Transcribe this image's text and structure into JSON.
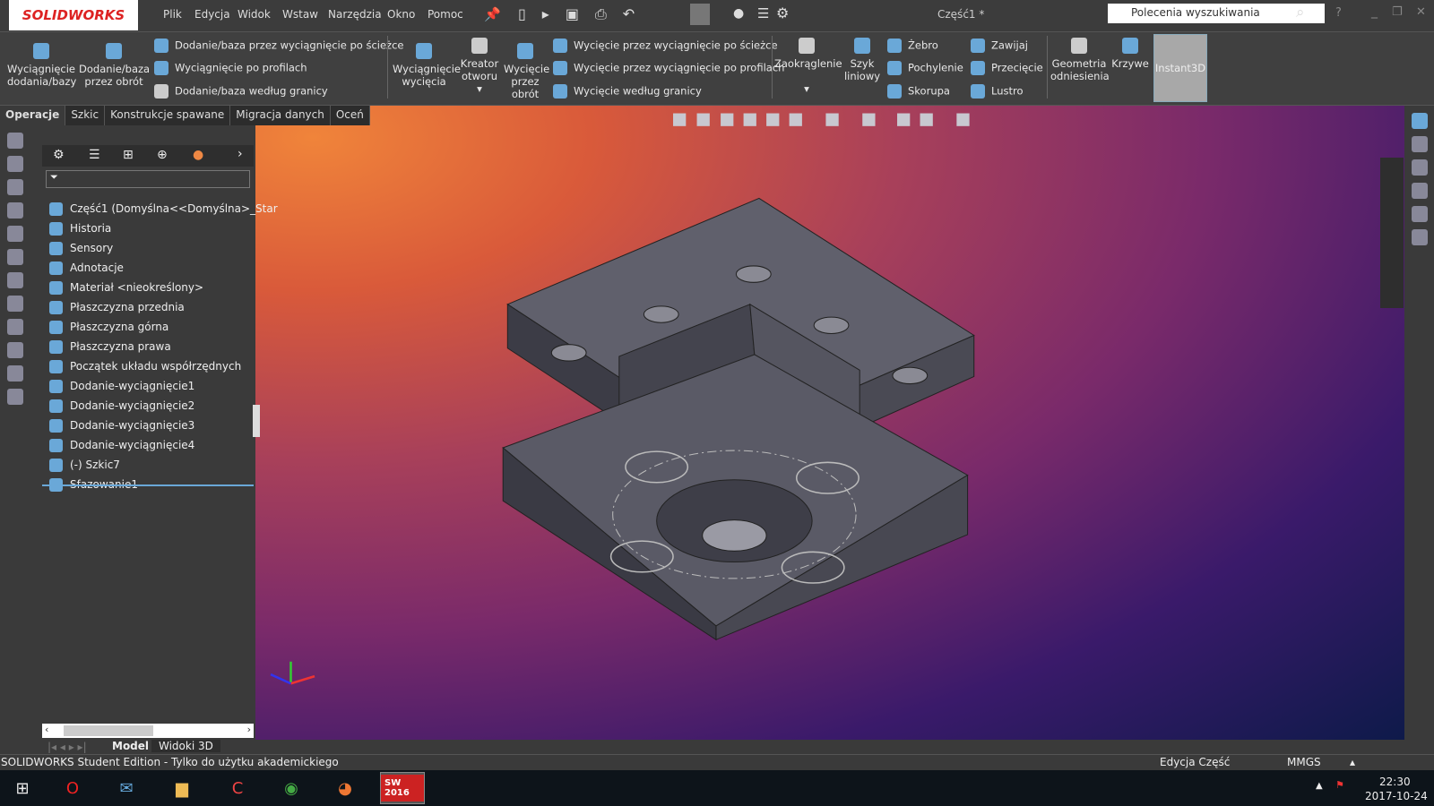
{
  "app": {
    "logo": "SOLIDWORKS",
    "title": "Część1 *",
    "search_placeholder": "Polecenia wyszukiwania"
  },
  "menu": [
    "Plik",
    "Edycja",
    "Widok",
    "Wstaw",
    "Narzędzia",
    "Okno",
    "Pomoc"
  ],
  "ribbon": {
    "extrude_boss": "Wyciągnięcie dodania/bazy",
    "revolve_boss": "Dodanie/baza przez obrót",
    "sweep_boss": "Dodanie/baza przez wyciągnięcie po ścieżce",
    "loft_boss": "Wyciągnięcie po profilach",
    "boundary_boss": "Dodanie/baza według granicy",
    "extrude_cut": "Wyciągnięcie wycięcia",
    "hole_wizard": "Kreator otworu",
    "revolve_cut": "Wycięcie przez obrót",
    "sweep_cut": "Wycięcie przez wyciągnięcie po ścieżce",
    "loft_cut": "Wycięcie przez wyciągnięcie po profilach",
    "boundary_cut": "Wycięcie według granicy",
    "fillet": "Zaokrąglenie",
    "linear_pattern": "Szyk liniowy",
    "rib": "Żebro",
    "draft": "Pochylenie",
    "shell": "Skorupa",
    "wrap": "Zawijaj",
    "intersect": "Przecięcie",
    "mirror": "Lustro",
    "ref_geometry": "Geometria odniesienia",
    "curves": "Krzywe",
    "instant3d": "Instant3D"
  },
  "tabs": [
    "Operacje",
    "Szkic",
    "Konstrukcje spawane",
    "Migracja danych",
    "Oceń"
  ],
  "tree": [
    "Część1  (Domyślna<<Domyślna>_Star",
    "Historia",
    "Sensory",
    "Adnotacje",
    "Materiał <nieokreślony>",
    "Płaszczyzna przednia",
    "Płaszczyzna górna",
    "Płaszczyzna prawa",
    "Początek układu współrzędnych",
    "Dodanie-wyciągnięcie1",
    "Dodanie-wyciągnięcie2",
    "Dodanie-wyciągnięcie3",
    "Dodanie-wyciągnięcie4",
    "(-) Szkic7",
    "Sfazowanie1"
  ],
  "model_tabs": [
    "Model",
    "Widoki 3D"
  ],
  "status": {
    "edition": "SOLIDWORKS Student Edition - Tylko do użytku akademickiego",
    "mode": "Edycja Część",
    "units": "MMGS"
  },
  "taskbar": {
    "time": "22:30",
    "date": "2017-10-24",
    "sw_badge": "SW 2016"
  },
  "colors": {
    "accent": "#6aa8d8",
    "model": "#52525c"
  }
}
